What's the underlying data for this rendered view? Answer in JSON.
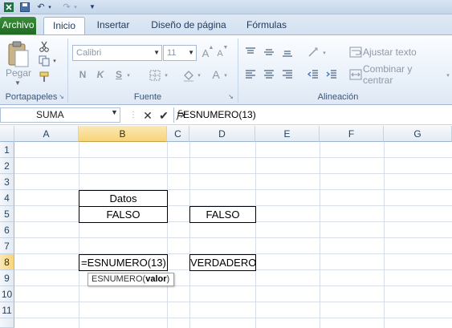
{
  "ribbon_tabs": {
    "file": "Archivo",
    "home": "Inicio",
    "insert": "Insertar",
    "page_layout": "Diseño de página",
    "formulas": "Fórmulas"
  },
  "clipboard": {
    "paste": "Pegar",
    "group": "Portapapeles"
  },
  "font": {
    "name": "Calibri",
    "size": "11",
    "bold": "N",
    "italic": "K",
    "underline": "S",
    "grow": "A",
    "shrink": "A",
    "color": "A",
    "group": "Fuente"
  },
  "alignment": {
    "wrap_text": "Ajustar texto",
    "merge": "Combinar y centrar",
    "group": "Alineación"
  },
  "formula_bar": {
    "name_box": "SUMA",
    "cancel": "✕",
    "enter": "✔",
    "fx": "fx",
    "formula": "=ESNUMERO(13)"
  },
  "columns": [
    "A",
    "B",
    "C",
    "D",
    "E",
    "F",
    "G"
  ],
  "rows": [
    "1",
    "2",
    "3",
    "4",
    "5",
    "6",
    "7",
    "8",
    "9",
    "10",
    "11"
  ],
  "cells": {
    "b4": "Datos",
    "b5": "FALSO",
    "d5": "FALSO",
    "b8": "=ESNUMERO(13)",
    "d8": "VERDADERO"
  },
  "tooltip": {
    "function": "ESNUMERO(",
    "arg": "valor",
    "close": ")"
  }
}
